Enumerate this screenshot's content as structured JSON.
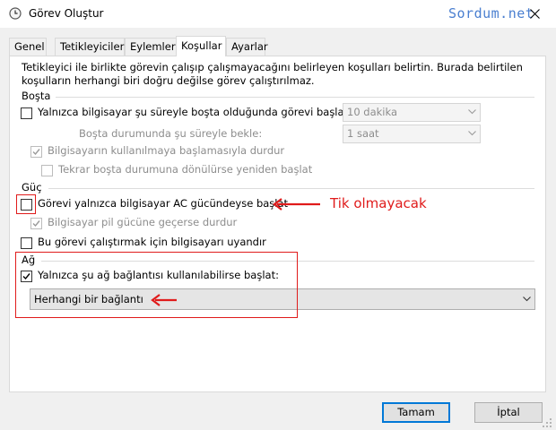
{
  "window": {
    "title": "Görev Oluştur",
    "watermark": "Sordum.net",
    "close_icon": "close-icon"
  },
  "tabs": [
    {
      "label": "Genel"
    },
    {
      "label": "Tetikleyiciler"
    },
    {
      "label": "Eylemler"
    },
    {
      "label": "Koşullar",
      "active": true
    },
    {
      "label": "Ayarlar"
    }
  ],
  "conditions": {
    "description": "Tetikleyici ile birlikte görevin çalışıp çalışmayacağını belirleyen koşulları belirtin. Burada belirtilen koşulların herhangi biri doğru değilse görev çalıştırılmaz.",
    "idle": {
      "section": "Boşta",
      "start_if_idle": {
        "label": "Yalnızca bilgisayar şu süreyle boşta olduğunda görevi başlat:",
        "checked": false
      },
      "idle_duration": {
        "value": "10 dakika"
      },
      "wait_label": "Boşta durumunda şu süreyle bekle:",
      "wait_duration": {
        "value": "1 saat"
      },
      "stop_if_not_idle": {
        "label": "Bilgisayarın kullanılmaya başlamasıyla durdur",
        "checked": true
      },
      "restart_if_idle": {
        "label": "Tekrar boşta durumuna dönülürse yeniden başlat",
        "checked": false
      }
    },
    "power": {
      "section": "Güç",
      "ac_only": {
        "label": "Görevi yalnızca bilgisayar AC gücündeyse başlat",
        "checked": false
      },
      "stop_on_battery": {
        "label": "Bilgisayar pil gücüne geçerse durdur",
        "checked": true
      },
      "wake_to_run": {
        "label": "Bu görevi çalıştırmak için bilgisayarı uyandır",
        "checked": false
      }
    },
    "network": {
      "section": "Ağ",
      "network_only": {
        "label": "Yalnızca şu ağ bağlantısı kullanılabilirse başlat:",
        "checked": true
      },
      "connection": {
        "value": "Herhangi bir bağlantı"
      }
    }
  },
  "annotation": {
    "text": "Tik olmayacak",
    "color": "#e01b1b"
  },
  "buttons": {
    "ok": "Tamam",
    "cancel": "İptal"
  }
}
